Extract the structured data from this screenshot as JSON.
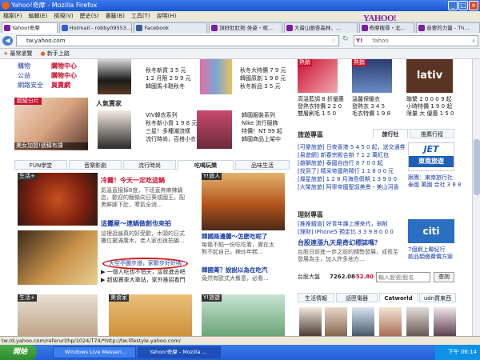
{
  "window": {
    "title": "Yahoo!奇摩 - Mozilla Firefox"
  },
  "menu": [
    "檔案(F)",
    "編輯(E)",
    "檢視(V)",
    "歷史(S)",
    "書籤(B)",
    "工具(T)",
    "說明(H)"
  ],
  "tabs": [
    {
      "label": "Yahoo!奇摩",
      "color": "#7b1fa2"
    },
    {
      "label": "Hotmail - robby09553....",
      "color": "#2b5fd9"
    },
    {
      "label": "Facebook",
      "color": "#3b5998"
    },
    {
      "label": "頂好肚肚熊:坐姿・昵...",
      "color": "#7b1fa2"
    },
    {
      "label": "大崙山銀杏森林、...",
      "color": "#7b1fa2"
    },
    {
      "label": "奇摩搜尋・北...",
      "color": "#7b1fa2"
    },
    {
      "label": "音要的力量 - Th...",
      "color": "#7b1fa2"
    }
  ],
  "nav": {
    "url": "tw.yahoo.com",
    "search_placeholder": "Yahoo",
    "logo": "YAHOO!"
  },
  "bookmarks": [
    "最常瀏覽",
    "新手上路"
  ],
  "left_col": {
    "links": [
      "購物",
      "公益",
      "網路安全",
      "購物中心",
      "購物中心",
      "買賣網"
    ],
    "tags": [
      "超級分片",
      "美女加盟!號稱有課"
    ],
    "shop_header": "人氣賣家",
    "shop_texts": [
      "秋冬新貨 3 5 元",
      "1 2 月限 2 9 9 元",
      "韓國馬卡鞋秋冬",
      "秋冬大特價 7 9 元",
      "韓國原創 1 9 8 元",
      "秋冬新品 3 5 元",
      "VIV韓衣系列",
      "秋冬新小貨 1 9 8 元",
      "三星！多種潮流樣",
      "流行時尚，百搭小衣",
      "韓國服裝系列",
      "Nike 流行服飾",
      "特價！NT 99 起",
      "韓國商品上架中"
    ]
  },
  "section_tabs": [
    "FUN學堂",
    "音樂影劇",
    "流行時尚",
    "吃喝玩樂",
    "品味生活"
  ],
  "main": {
    "label_life": "生活+",
    "story1_title": "冷霧！今天一定吃這鍋",
    "story1_body": [
      "氣溫直接掉8度，下班直奔麻辣鍋",
      "店，歡迎的麵條向日葵或國王，配",
      "黑鮮豚下肚，寒氣全消..."
    ],
    "story2_label": "Y!旅人",
    "story2_title": "這攤屋～連鍋做創也來拍",
    "story2_body": [
      "這裡逛遍真的好受歡，木頭的日式",
      "攤位擺滿廣木，老人家也很拍攝..."
    ],
    "story3_title": "韓國路邊攤～怎麼吃呢了",
    "story3_body": [
      "每條不點一份吃吃看，實在太",
      "對不起自己，辣炒年糕..."
    ],
    "story4_title": "韓國菁？說說以為在吃汽",
    "story4_body": [
      "竟然有歐式大餐意，必看..."
    ],
    "circled": "天空亭圖步道，家歡步好好嗎",
    "list": [
      "▶ 一個人吃也不怕天，這就進去吧",
      "▶ 超級賽車大車站，家外推招看門"
    ],
    "bottom_labels": [
      "生活+",
      "美食家",
      "Y!旅遊"
    ]
  },
  "right_col": {
    "hot_label": "熱銷",
    "products": [
      {
        "lines": [
          "高溫藍調 8 折優惠",
          "發熱衣特價 2 2 0",
          "雙層刷毛 1 5 0"
        ]
      },
      {
        "lines": [
          "溫馨保暖衣",
          "發熱衣 3 4 5",
          "毛衣特價 1 9 8"
        ]
      },
      {
        "lines": [
          "熊貓可愛的大衣",
          "時尚鴨絨 2 5 0",
          "熱銷NT1 0 0 0"
        ]
      }
    ],
    "lativ": [
      "lativ",
      "聯繫 2 0 0 0 9 起",
      "小時特價 1 9 0 起",
      "限量 大 優惠 1 5 0"
    ],
    "travel": {
      "label": "旅遊專區",
      "tabs": [
        "旅行社",
        "推薦行程"
      ],
      "items": [
        "[可樂旅遊] 日夜香港 5 4 5 0 起，送交通券",
        "[易遊網] 新春宗殿合辦 7 1 2 萬紅包",
        "[雄獅旅遊] 泰國自由行 8 7 0 0 起",
        "[找到了] 精采帝國熱鬧行 1 1 8 0 0 元",
        "[燦星旅遊] 1 2 8 月海島假期 1 3 9 0 0",
        "[大榮旅遊] 阿寧帝國聖誕美景・美山河香"
      ],
      "jet": "JET",
      "jet_sub": "東南旅遊",
      "jet_lines": [
        "跟團：東南旅行社",
        "泰國 萬國 合社 3 8 8 0 0 起"
      ]
    },
    "finance": {
      "label": "理財專區",
      "news": [
        "[推推鐵道] 好青年護上煙來代，剝削",
        "[理財] iPhone5 預定比 3 3 9 8 0 0 0"
      ],
      "headline": "台股連漲九天是奇幻標誌嗎？",
      "body": [
        "台股日前進一歩之前的錢勢發展，成長至",
        "發展為主，加入許多地方..."
      ],
      "index_label": "台股大盤",
      "index_value": "7262.08",
      "index_change": "-52.80",
      "quote_placeholder": "輸入股號/股名",
      "quote_button": "查詢",
      "citi": "citi",
      "citi_lines": [
        "7個網上聯紀行",
        "款品類繳費價方案"
      ]
    },
    "bottom_tabs": [
      "生活情報",
      "話匣電器",
      "Catworld",
      "udn買東西"
    ]
  },
  "status_text": "tw.rd.yahoo.com/referurl/hp/1024/T74/*http://tw.lifestyle.yahoo.com/",
  "taskbar": {
    "start": "開始",
    "items": [
      "Windows Live Messen...",
      "Yahoo!奇摩 - Mozilla ..."
    ],
    "clock": "下午 06:14"
  }
}
